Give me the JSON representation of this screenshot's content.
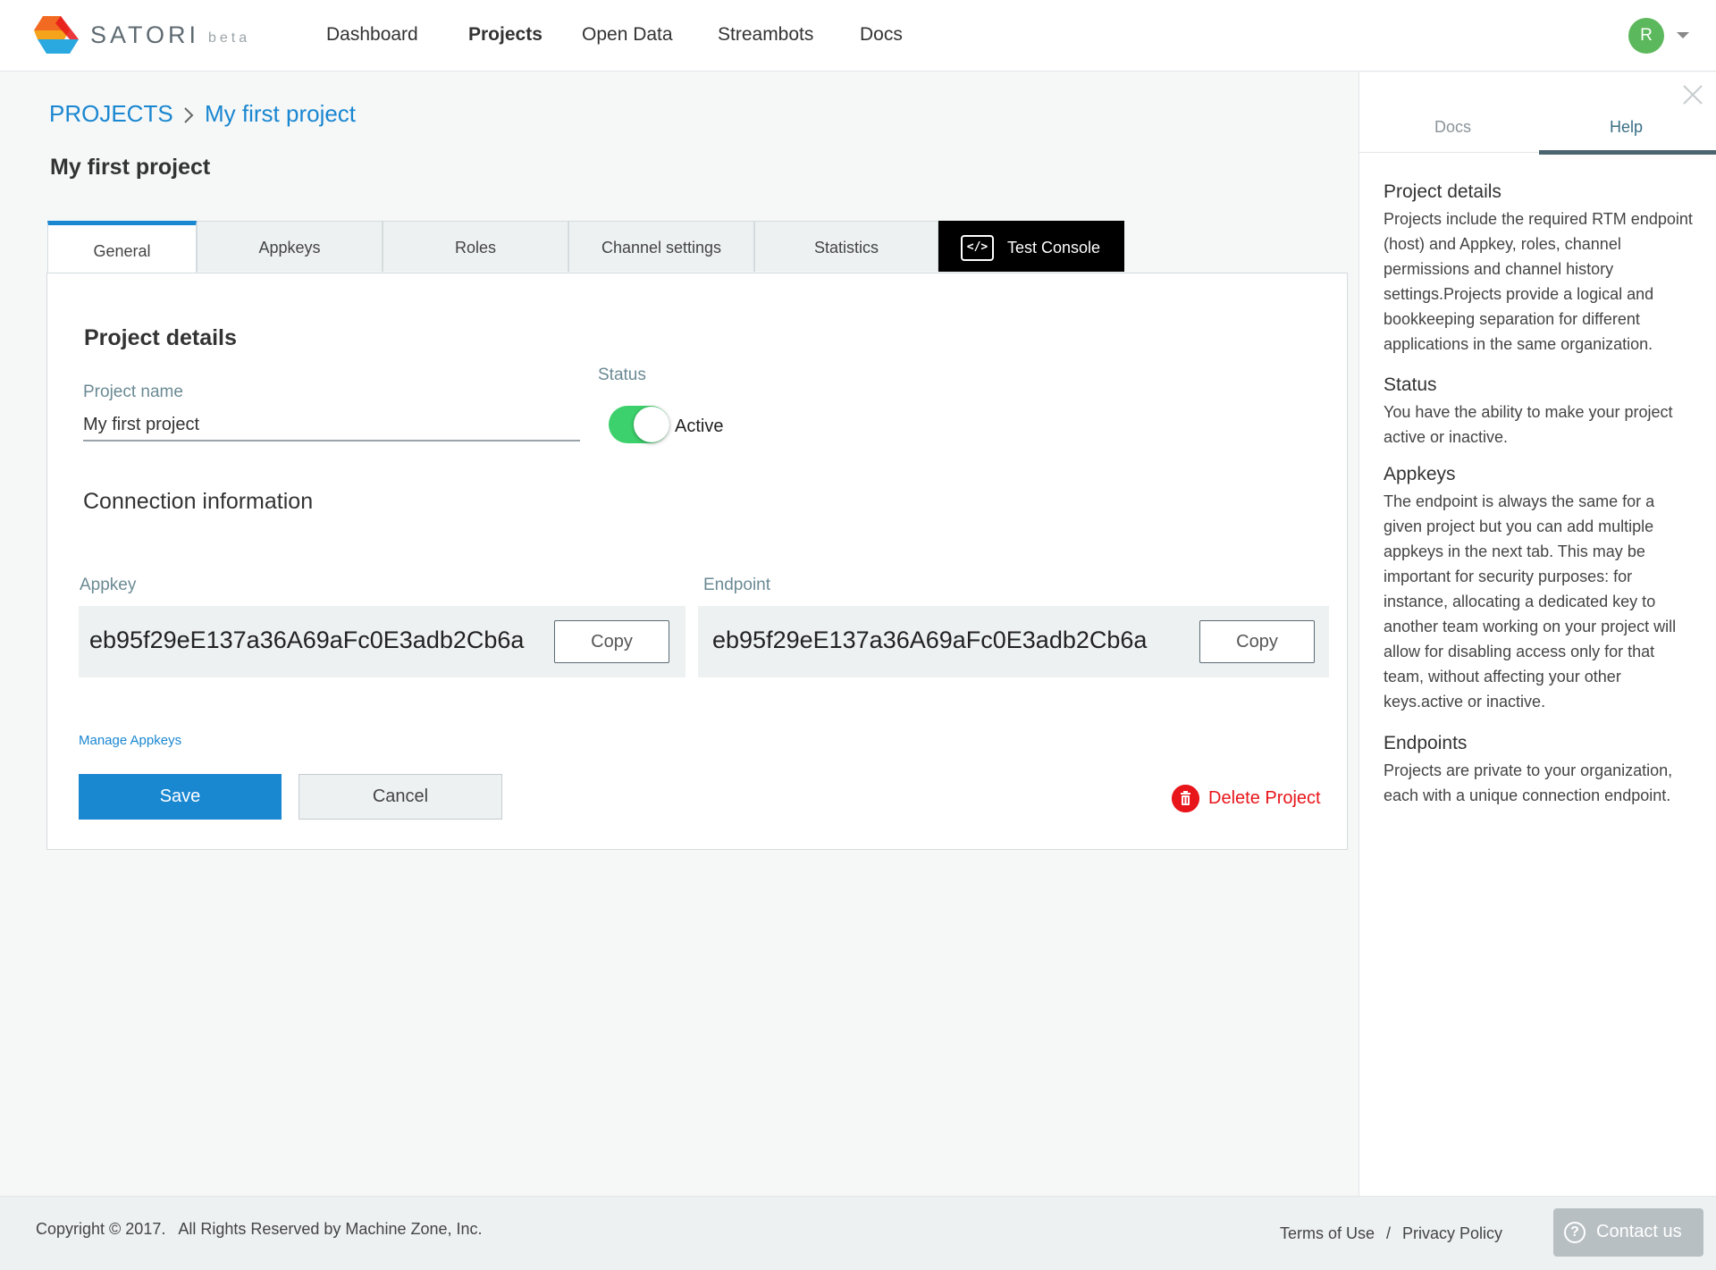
{
  "header": {
    "brand": "SATORI",
    "brand_tag": "beta",
    "nav": [
      "Dashboard",
      "Projects",
      "Open Data",
      "Streambots",
      "Docs"
    ],
    "active_nav": "Projects",
    "avatar_initial": "R"
  },
  "breadcrumb": {
    "root": "PROJECTS",
    "current": "My first project"
  },
  "page_title": "My first project",
  "tabs": [
    "General",
    "Appkeys",
    "Roles",
    "Channel settings",
    "Statistics",
    "Test Console"
  ],
  "active_tab": "General",
  "project_details": {
    "heading": "Project details",
    "name_label": "Project name",
    "name_value": "My first project",
    "status_label": "Status",
    "status_value": "Active",
    "status_on": true
  },
  "connection": {
    "heading": "Connection information",
    "appkey_label": "Appkey",
    "appkey_value": "eb95f29eE137a36A69aFc0E3adb2Cb6a",
    "endpoint_label": "Endpoint",
    "endpoint_value": "eb95f29eE137a36A69aFc0E3adb2Cb6a",
    "copy_label": "Copy"
  },
  "actions": {
    "manage_link": "Manage Appkeys",
    "save": "Save",
    "cancel": "Cancel",
    "delete": "Delete Project"
  },
  "help_panel": {
    "tabs": [
      "Docs",
      "Help"
    ],
    "active_tab": "Help",
    "sections": [
      {
        "title": "Project details",
        "body": "Projects include the required RTM endpoint (host) and Appkey, roles, channel permissions and channel history settings.Projects provide a logical and bookkeeping separation for different applications in the same organization."
      },
      {
        "title": "Status",
        "body": "You have the ability to make your project active or inactive."
      },
      {
        "title": "Appkeys",
        "body": "The endpoint is always the same for a given project but you can add multiple appkeys in the next tab. This may be important for security purposes: for instance, allocating a dedicated key to another team working on your project will allow for disabling access only for that team, without affecting your other keys.active or inactive."
      },
      {
        "title": "Endpoints",
        "body": "Projects are private to your organization, each with a unique connection endpoint."
      }
    ]
  },
  "footer": {
    "copyright": "Copyright © 2017.   All Rights Reserved by Machine Zone, Inc.",
    "terms": "Terms of Use",
    "separator": "/",
    "privacy": "Privacy Policy",
    "contact": "Contact us"
  },
  "colors": {
    "accent": "#1a87d1",
    "toggle_on": "#3dd16d",
    "danger": "#e8151a",
    "avatar": "#5cb85c"
  }
}
